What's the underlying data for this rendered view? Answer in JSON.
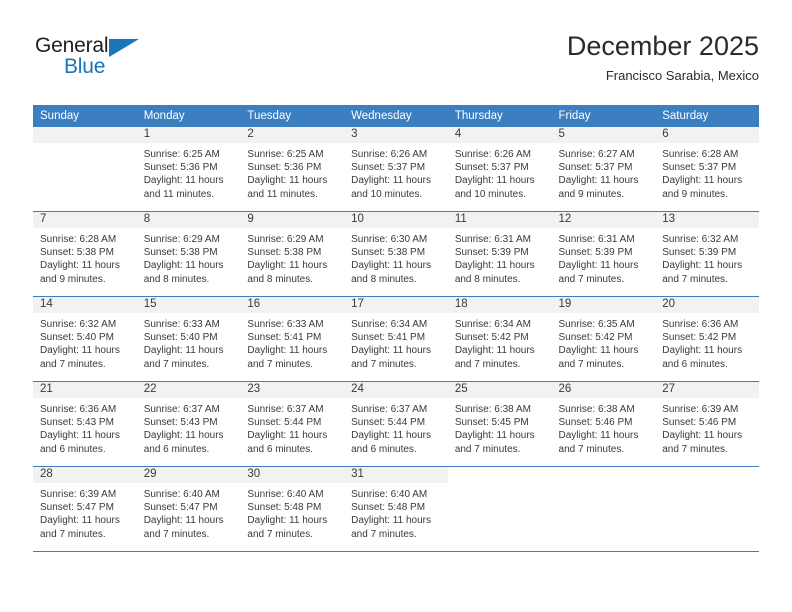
{
  "logo": {
    "word_top": "General",
    "word_bottom": "Blue",
    "triangle_color": "#1b75bb",
    "icon": "generalblue-logo"
  },
  "header": {
    "title": "December 2025",
    "subtitle": "Francisco Sarabia, Mexico"
  },
  "theme": {
    "header_row_bg": "#3c7fc1",
    "daynum_band_bg": "#f2f2f2",
    "text_color": "#3a3a3a"
  },
  "weekdays": [
    "Sunday",
    "Monday",
    "Tuesday",
    "Wednesday",
    "Thursday",
    "Friday",
    "Saturday"
  ],
  "weeks": [
    [
      {
        "day": "",
        "lines": []
      },
      {
        "day": "1",
        "lines": [
          "Sunrise: 6:25 AM",
          "Sunset: 5:36 PM",
          "Daylight: 11 hours",
          "and 11 minutes."
        ]
      },
      {
        "day": "2",
        "lines": [
          "Sunrise: 6:25 AM",
          "Sunset: 5:36 PM",
          "Daylight: 11 hours",
          "and 11 minutes."
        ]
      },
      {
        "day": "3",
        "lines": [
          "Sunrise: 6:26 AM",
          "Sunset: 5:37 PM",
          "Daylight: 11 hours",
          "and 10 minutes."
        ]
      },
      {
        "day": "4",
        "lines": [
          "Sunrise: 6:26 AM",
          "Sunset: 5:37 PM",
          "Daylight: 11 hours",
          "and 10 minutes."
        ]
      },
      {
        "day": "5",
        "lines": [
          "Sunrise: 6:27 AM",
          "Sunset: 5:37 PM",
          "Daylight: 11 hours",
          "and 9 minutes."
        ]
      },
      {
        "day": "6",
        "lines": [
          "Sunrise: 6:28 AM",
          "Sunset: 5:37 PM",
          "Daylight: 11 hours",
          "and 9 minutes."
        ]
      }
    ],
    [
      {
        "day": "7",
        "lines": [
          "Sunrise: 6:28 AM",
          "Sunset: 5:38 PM",
          "Daylight: 11 hours",
          "and 9 minutes."
        ]
      },
      {
        "day": "8",
        "lines": [
          "Sunrise: 6:29 AM",
          "Sunset: 5:38 PM",
          "Daylight: 11 hours",
          "and 8 minutes."
        ]
      },
      {
        "day": "9",
        "lines": [
          "Sunrise: 6:29 AM",
          "Sunset: 5:38 PM",
          "Daylight: 11 hours",
          "and 8 minutes."
        ]
      },
      {
        "day": "10",
        "lines": [
          "Sunrise: 6:30 AM",
          "Sunset: 5:38 PM",
          "Daylight: 11 hours",
          "and 8 minutes."
        ]
      },
      {
        "day": "11",
        "lines": [
          "Sunrise: 6:31 AM",
          "Sunset: 5:39 PM",
          "Daylight: 11 hours",
          "and 8 minutes."
        ]
      },
      {
        "day": "12",
        "lines": [
          "Sunrise: 6:31 AM",
          "Sunset: 5:39 PM",
          "Daylight: 11 hours",
          "and 7 minutes."
        ]
      },
      {
        "day": "13",
        "lines": [
          "Sunrise: 6:32 AM",
          "Sunset: 5:39 PM",
          "Daylight: 11 hours",
          "and 7 minutes."
        ]
      }
    ],
    [
      {
        "day": "14",
        "lines": [
          "Sunrise: 6:32 AM",
          "Sunset: 5:40 PM",
          "Daylight: 11 hours",
          "and 7 minutes."
        ]
      },
      {
        "day": "15",
        "lines": [
          "Sunrise: 6:33 AM",
          "Sunset: 5:40 PM",
          "Daylight: 11 hours",
          "and 7 minutes."
        ]
      },
      {
        "day": "16",
        "lines": [
          "Sunrise: 6:33 AM",
          "Sunset: 5:41 PM",
          "Daylight: 11 hours",
          "and 7 minutes."
        ]
      },
      {
        "day": "17",
        "lines": [
          "Sunrise: 6:34 AM",
          "Sunset: 5:41 PM",
          "Daylight: 11 hours",
          "and 7 minutes."
        ]
      },
      {
        "day": "18",
        "lines": [
          "Sunrise: 6:34 AM",
          "Sunset: 5:42 PM",
          "Daylight: 11 hours",
          "and 7 minutes."
        ]
      },
      {
        "day": "19",
        "lines": [
          "Sunrise: 6:35 AM",
          "Sunset: 5:42 PM",
          "Daylight: 11 hours",
          "and 7 minutes."
        ]
      },
      {
        "day": "20",
        "lines": [
          "Sunrise: 6:36 AM",
          "Sunset: 5:42 PM",
          "Daylight: 11 hours",
          "and 6 minutes."
        ]
      }
    ],
    [
      {
        "day": "21",
        "lines": [
          "Sunrise: 6:36 AM",
          "Sunset: 5:43 PM",
          "Daylight: 11 hours",
          "and 6 minutes."
        ]
      },
      {
        "day": "22",
        "lines": [
          "Sunrise: 6:37 AM",
          "Sunset: 5:43 PM",
          "Daylight: 11 hours",
          "and 6 minutes."
        ]
      },
      {
        "day": "23",
        "lines": [
          "Sunrise: 6:37 AM",
          "Sunset: 5:44 PM",
          "Daylight: 11 hours",
          "and 6 minutes."
        ]
      },
      {
        "day": "24",
        "lines": [
          "Sunrise: 6:37 AM",
          "Sunset: 5:44 PM",
          "Daylight: 11 hours",
          "and 6 minutes."
        ]
      },
      {
        "day": "25",
        "lines": [
          "Sunrise: 6:38 AM",
          "Sunset: 5:45 PM",
          "Daylight: 11 hours",
          "and 7 minutes."
        ]
      },
      {
        "day": "26",
        "lines": [
          "Sunrise: 6:38 AM",
          "Sunset: 5:46 PM",
          "Daylight: 11 hours",
          "and 7 minutes."
        ]
      },
      {
        "day": "27",
        "lines": [
          "Sunrise: 6:39 AM",
          "Sunset: 5:46 PM",
          "Daylight: 11 hours",
          "and 7 minutes."
        ]
      }
    ],
    [
      {
        "day": "28",
        "lines": [
          "Sunrise: 6:39 AM",
          "Sunset: 5:47 PM",
          "Daylight: 11 hours",
          "and 7 minutes."
        ]
      },
      {
        "day": "29",
        "lines": [
          "Sunrise: 6:40 AM",
          "Sunset: 5:47 PM",
          "Daylight: 11 hours",
          "and 7 minutes."
        ]
      },
      {
        "day": "30",
        "lines": [
          "Sunrise: 6:40 AM",
          "Sunset: 5:48 PM",
          "Daylight: 11 hours",
          "and 7 minutes."
        ]
      },
      {
        "day": "31",
        "lines": [
          "Sunrise: 6:40 AM",
          "Sunset: 5:48 PM",
          "Daylight: 11 hours",
          "and 7 minutes."
        ]
      },
      {
        "day": "",
        "lines": []
      },
      {
        "day": "",
        "lines": []
      },
      {
        "day": "",
        "lines": []
      }
    ]
  ]
}
